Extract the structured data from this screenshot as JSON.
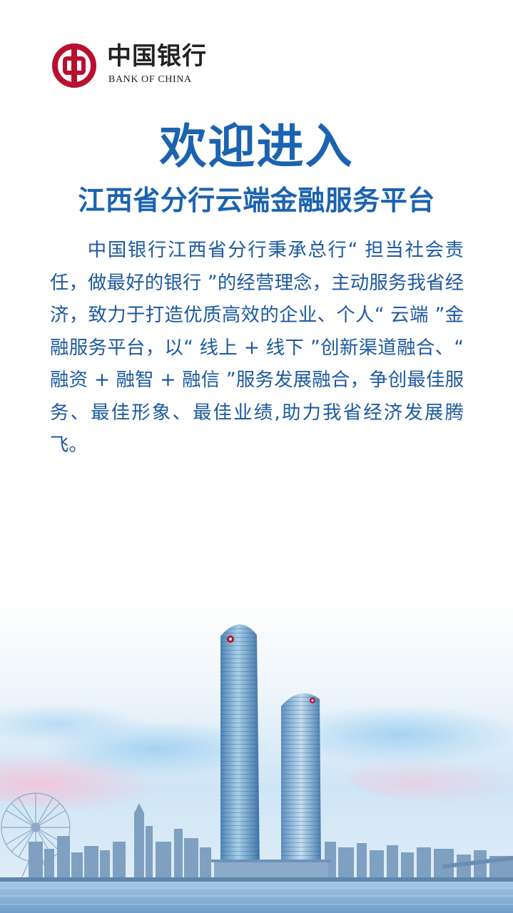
{
  "brand": {
    "name_cn": "中国银行",
    "name_en": "BANK OF CHINA",
    "color": "#b8102e"
  },
  "heading": {
    "title": "欢迎进入",
    "subtitle": "江西省分行云端金融服务平台",
    "color": "#1b63b1"
  },
  "intro": {
    "text": "中国银行江西省分行秉承总行“ 担当社会责任，做最好的银行 ”的经营理念，主动服务我省经济，致力于打造优质高效的企业、个人“ 云端 ”金融服务平台，以“ 线上 + 线下 ”创新渠道融合、“ 融资 + 融智 + 融信 ”服务发展融合，争创最佳服务、最佳形象、最佳业绩,助力我省经济发展腾飞。",
    "color": "#1d5aa0"
  },
  "banner": {
    "icon": "city-skyline-illustration"
  }
}
